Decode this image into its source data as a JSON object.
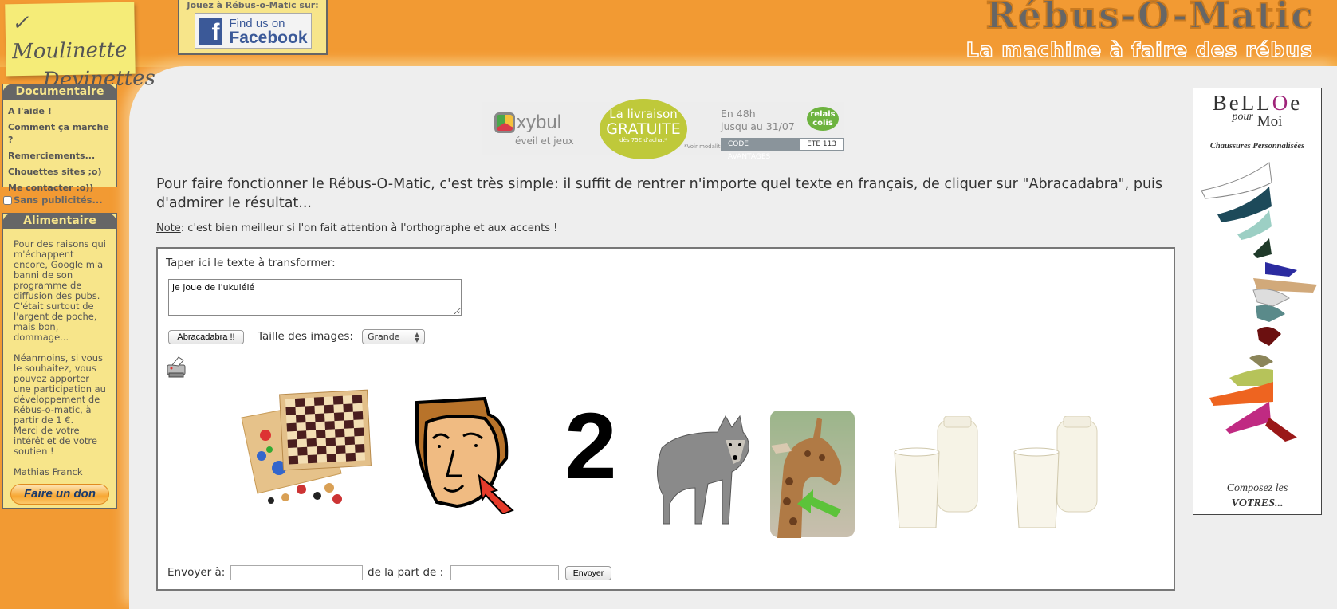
{
  "header": {
    "logo_line1": "Moulinette",
    "logo_line2": "Devinettes",
    "facebook_label": "Jouez à Rébus-o-Matic sur:",
    "facebook_button_line1": "Find us on",
    "facebook_button_line2": "Facebook",
    "site_title": "Rébus-O-Matic",
    "site_subtitle": "La machine à faire des rébus"
  },
  "sidebar": {
    "doc_title": "Documentaire",
    "doc_items": [
      {
        "label": "A l'aide !"
      },
      {
        "label": "Comment ça marche ?"
      },
      {
        "label": "Remerciements..."
      },
      {
        "label": "Chouettes sites   ;o)"
      },
      {
        "label": "Me contacter   :o))"
      }
    ],
    "no_ads_label": "Sans publicités...",
    "no_ads_checked": false,
    "ali_title": "Alimentaire",
    "ali_text": "Pour des raisons qui m'échappent encore, Google m'a banni de son programme de diffusion des pubs. C'était surtout de l'argent de poche, mais bon, dommage...\n\nNéanmoins, si vous le souhaitez, vous pouvez apporter une participation au développement de Rébus-o-matic, à partir de 1 €.\nMerci de votre intérêt et de votre soutien !\n\nMathias Franck",
    "donate_label": "Faire un don"
  },
  "promo": {
    "brand": "xybul",
    "tagline": "éveil et jeux",
    "circle_line1": "La livraison",
    "circle_line2": "GRATUITE",
    "circle_line3": "dès 75€ d'achat*",
    "conditions": "*Voir modalités",
    "delivery_line1": "En 48h",
    "delivery_line2": "jusqu'au 31/07",
    "relais_line1": "relais",
    "relais_line2": "colis",
    "code_label": "CODE AVANTAGES",
    "code_value": "ETE 113"
  },
  "main": {
    "intro": "Pour faire fonctionner le Rébus-O-Matic, c'est très simple: il suffit de rentrer n'importe quel texte en français, de cliquer sur \"Abracadabra\", puis d'admirer le résultat...",
    "note_label": "Note",
    "note_text": ": c'est bien meilleur si l'on fait attention à l'orthographe et aux accents !"
  },
  "form": {
    "input_label": "Taper ici le texte à transformer:",
    "input_value": "je joue de l'ukulélé",
    "submit_label": "Abracadabra !!",
    "size_label": "Taille des images:",
    "size_value": "Grande",
    "rebus_images": [
      "board-games-image",
      "face-cheek-image",
      "number-2",
      "wolf-image",
      "giraffe-neck-image",
      "milk-image",
      "milk-image"
    ],
    "rebus_number": "2",
    "send_to_label": "Envoyer à:",
    "send_to_value": "",
    "from_label": "de la part de :",
    "from_value": "",
    "send_label": "Envoyer"
  },
  "ad": {
    "brand": "BeLLOe",
    "pour": "pour",
    "moi": "Moi",
    "subtitle": "Chaussures Personnalisées",
    "cta_line1": "Composez les",
    "cta_line2": "VOTRES..."
  },
  "colors": {
    "orange": "#f29a33",
    "panel_yellow": "#f7e58a",
    "panel_header": "#666666",
    "page_gray": "#eeeeee"
  }
}
